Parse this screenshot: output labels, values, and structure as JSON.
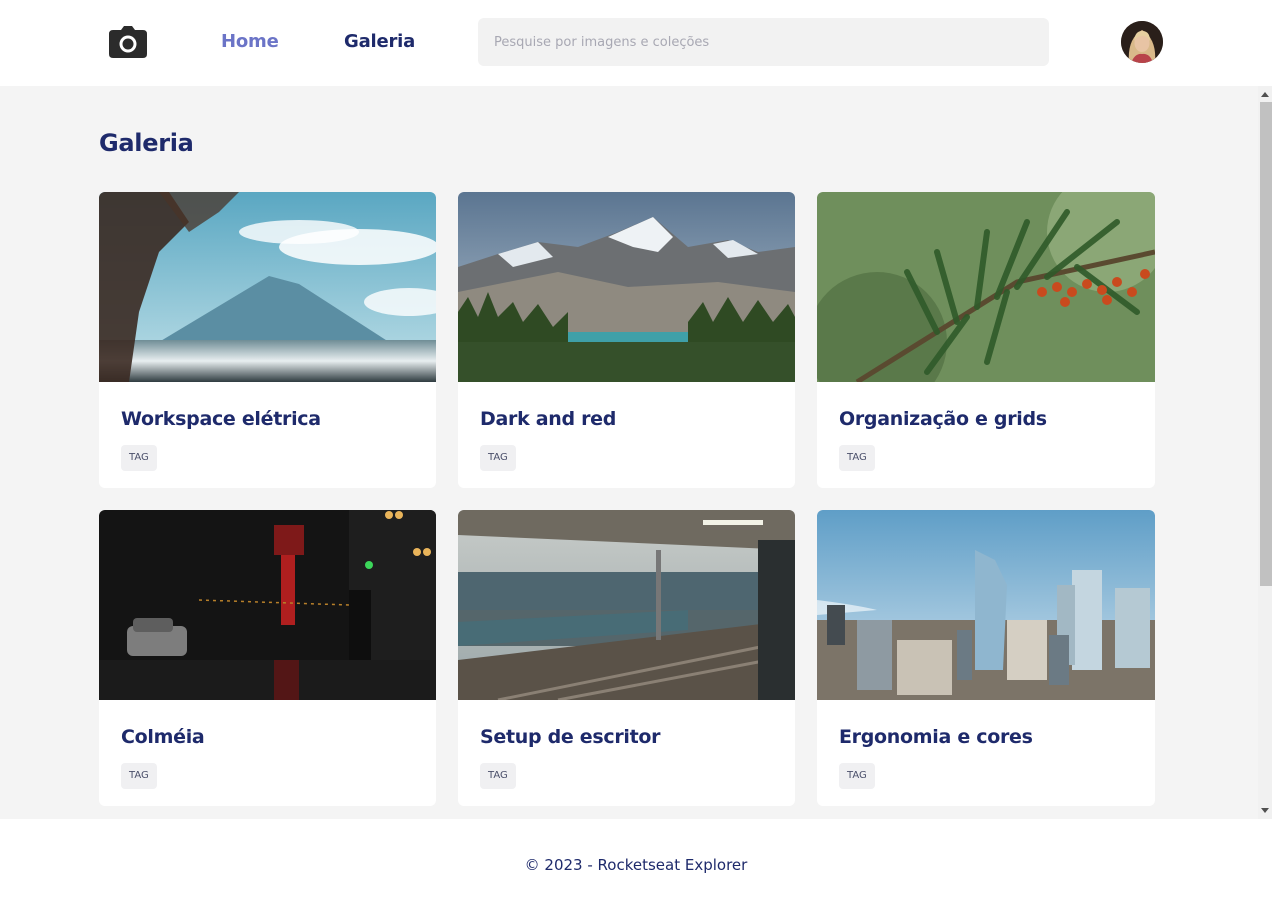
{
  "header": {
    "logo_icon": "camera-icon",
    "nav": {
      "home_label": "Home",
      "galeria_label": "Galeria"
    },
    "search": {
      "placeholder": "Pesquise por imagens e coleções",
      "value": ""
    },
    "avatar_icon": "user-avatar"
  },
  "main": {
    "title": "Galeria",
    "cards": [
      {
        "title": "Workspace elétrica",
        "tag": "TAG",
        "image": "lake-mountain-branches"
      },
      {
        "title": "Dark and red",
        "tag": "TAG",
        "image": "snowy-mountains-forest-lake"
      },
      {
        "title": "Organização e grids",
        "tag": "TAG",
        "image": "green-branch-red-berries"
      },
      {
        "title": "Colméia",
        "tag": "TAG",
        "image": "night-street-neon-sign"
      },
      {
        "title": "Setup de escritor",
        "tag": "TAG",
        "image": "seaside-train-platform"
      },
      {
        "title": "Ergonomia e cores",
        "tag": "TAG",
        "image": "city-skyscrapers-skyline"
      }
    ]
  },
  "footer": {
    "text": "© 2023 - Rocketseat Explorer"
  },
  "colors": {
    "primary": "#1e2a6b",
    "nav_active": "#6b74c7",
    "background": "#f4f4f4",
    "surface": "#ffffff"
  }
}
